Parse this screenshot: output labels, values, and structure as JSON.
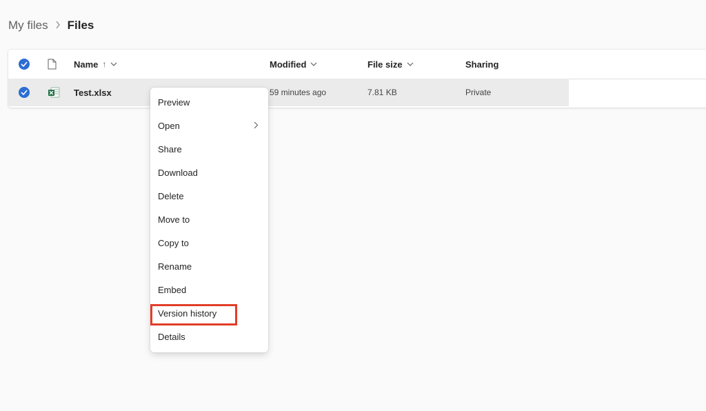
{
  "breadcrumb": {
    "parent": "My files",
    "current": "Files"
  },
  "columns": {
    "name": "Name",
    "name_sort_arrow": "↑",
    "modified": "Modified",
    "file_size": "File size",
    "sharing": "Sharing"
  },
  "file": {
    "name": "Test.xlsx",
    "modified": "59 minutes ago",
    "size": "7.81 KB",
    "sharing": "Private",
    "icon": "excel-file-icon"
  },
  "context_menu": {
    "items": [
      "Preview",
      "Open",
      "Share",
      "Download",
      "Delete",
      "Move to",
      "Copy to",
      "Rename",
      "Embed",
      "Version history",
      "Details"
    ],
    "highlighted": "Version history"
  },
  "colors": {
    "accent": "#2b6dd4",
    "highlight": "#e23d28",
    "excel": "#1d6f42"
  }
}
